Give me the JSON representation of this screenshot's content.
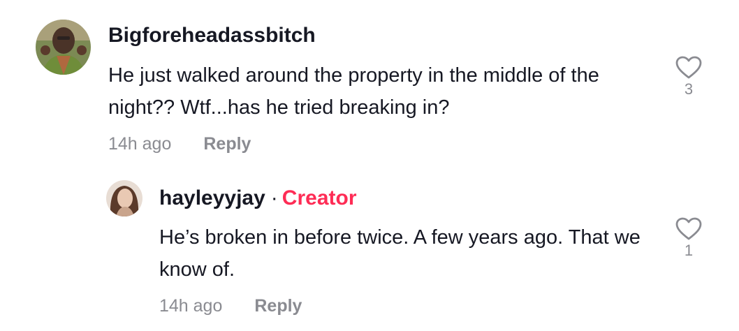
{
  "comments": [
    {
      "username": "Bigforeheadassbitch",
      "text": "He just walked around the property in the middle of the night?? Wtf...has he tried breaking in?",
      "time": "14h ago",
      "reply_label": "Reply",
      "likes": "3",
      "avatar_icon": "avatar-photo-man-green-jacket"
    },
    {
      "username": "hayleyyjay",
      "separator": "·",
      "badge": "Creator",
      "text": "He’s broken in before twice. A few years ago. That we know of.",
      "time": "14h ago",
      "reply_label": "Reply",
      "likes": "1",
      "avatar_icon": "avatar-photo-woman"
    }
  ],
  "colors": {
    "text": "#161823",
    "muted": "#8a8b91",
    "creator_badge": "#FE2C55"
  },
  "icons": {
    "like": "heart-outline-icon"
  }
}
